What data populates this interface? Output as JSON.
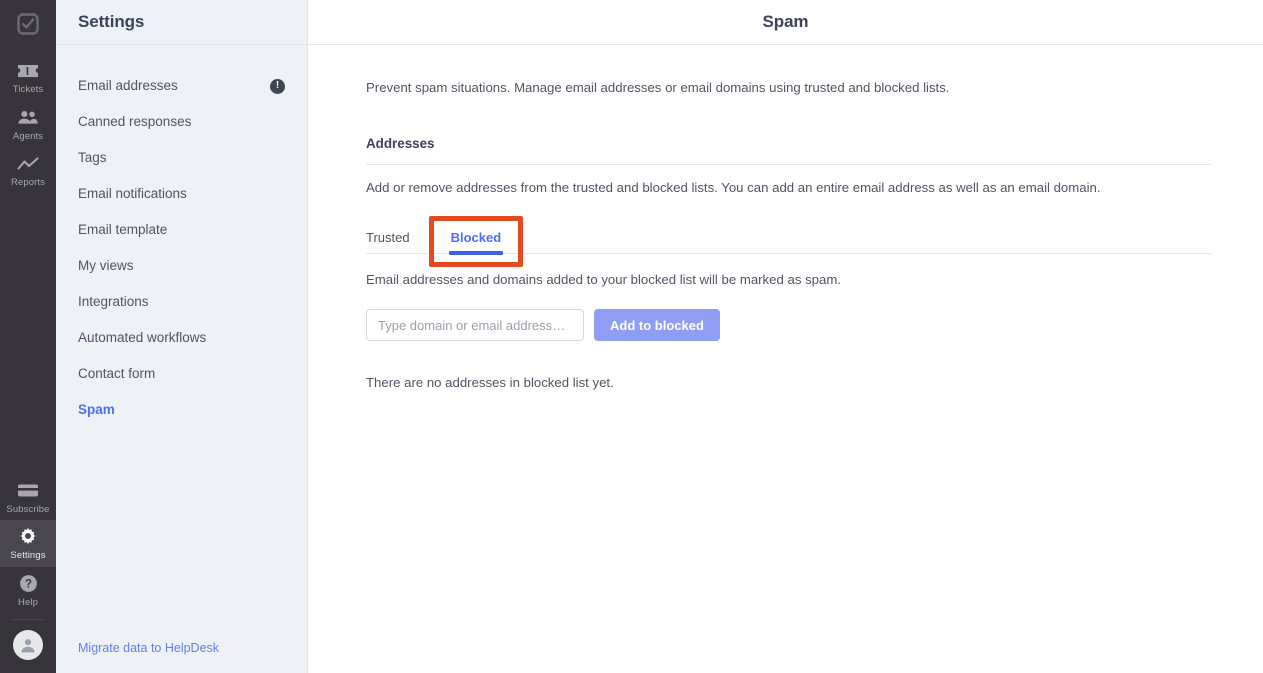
{
  "colors": {
    "rail_bg": "#37343c",
    "rail_active": "#4a4751",
    "settings_bg": "#eef2f6",
    "accent_blue": "#4d6ef5",
    "tab_underline": "#4062e8",
    "annotation": "#e4491f",
    "button_disabled": "#8f9df2",
    "badge_dark": "#3f4554"
  },
  "rail": {
    "logo_icon": "checkbox-check-logo-icon",
    "top_items": [
      {
        "label": "Tickets",
        "icon": "ticket-icon",
        "active": false
      },
      {
        "label": "Agents",
        "icon": "people-icon",
        "active": false
      },
      {
        "label": "Reports",
        "icon": "trendline-icon",
        "active": false
      }
    ],
    "bottom_items": [
      {
        "label": "Subscribe",
        "icon": "credit-card-icon",
        "active": false
      },
      {
        "label": "Settings",
        "icon": "gear-icon",
        "active": true
      },
      {
        "label": "Help",
        "icon": "question-circle-icon",
        "active": false
      }
    ],
    "avatar_icon": "user-avatar-icon"
  },
  "settings": {
    "title": "Settings",
    "nav": [
      {
        "label": "Email addresses",
        "badge": "!",
        "active": false
      },
      {
        "label": "Canned responses",
        "badge": null,
        "active": false
      },
      {
        "label": "Tags",
        "badge": null,
        "active": false
      },
      {
        "label": "Email notifications",
        "badge": null,
        "active": false
      },
      {
        "label": "Email template",
        "badge": null,
        "active": false
      },
      {
        "label": "My views",
        "badge": null,
        "active": false
      },
      {
        "label": "Integrations",
        "badge": null,
        "active": false
      },
      {
        "label": "Automated workflows",
        "badge": null,
        "active": false
      },
      {
        "label": "Contact form",
        "badge": null,
        "active": false
      },
      {
        "label": "Spam",
        "badge": null,
        "active": true
      }
    ],
    "migrate_link": "Migrate data to HelpDesk"
  },
  "main": {
    "title": "Spam",
    "lead": "Prevent spam situations. Manage email addresses or email domains using trusted and blocked lists.",
    "section_heading": "Addresses",
    "section_desc": "Add or remove addresses from the trusted and blocked lists. You can add an entire email address as well as an email domain.",
    "tabs": [
      {
        "label": "Trusted",
        "active": false
      },
      {
        "label": "Blocked",
        "active": true
      }
    ],
    "tab_desc": "Email addresses and domains added to your blocked list will be marked as spam.",
    "input": {
      "value": "",
      "placeholder": "Type domain or email address…"
    },
    "add_button": "Add to blocked",
    "empty_state": "There are no addresses in blocked list yet."
  }
}
